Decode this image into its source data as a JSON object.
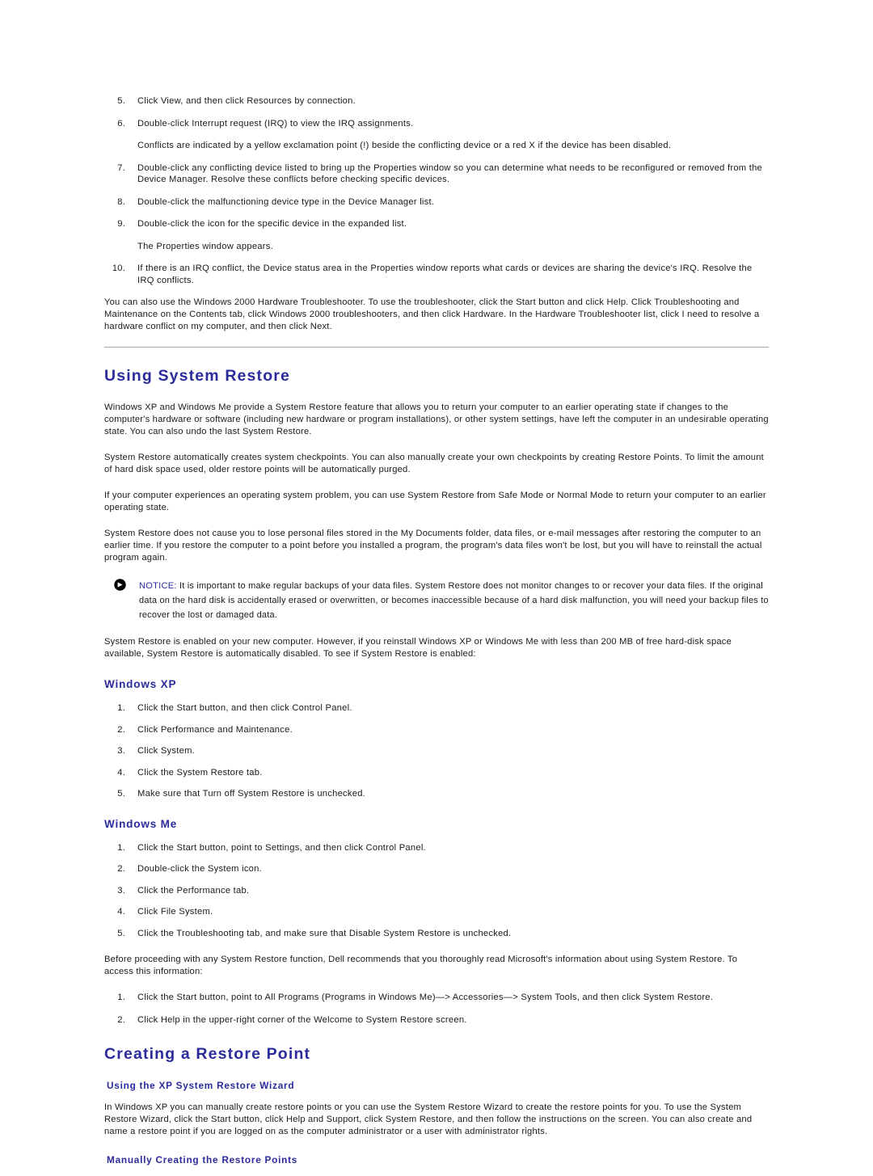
{
  "document": {
    "steps_continued": [
      {
        "num": "5.",
        "text": "Click View, and then click Resources by connection."
      },
      {
        "num": "6.",
        "text": "Double-click Interrupt request (IRQ) to view the IRQ assignments."
      }
    ],
    "conflict_note": "Conflicts are indicated by a yellow exclamation point (!) beside the conflicting device or a red X if the device has been disabled.",
    "steps_continued_2": [
      {
        "num": "7.",
        "text": "Double-click any conflicting device listed to bring up the Properties window so you can determine what needs to be reconfigured or removed from the Device Manager. Resolve these conflicts before checking specific devices."
      },
      {
        "num": "8.",
        "text": "Double-click the malfunctioning device type in the Device Manager list."
      },
      {
        "num": "9.",
        "text": "Double-click the icon for the specific device in the expanded list."
      }
    ],
    "properties_note": "The Properties window appears.",
    "steps_continued_3": [
      {
        "num": "10.",
        "text": "If there is an IRQ conflict, the Device status area in the Properties window reports what cards or devices are sharing the device's IRQ. Resolve the IRQ conflicts."
      }
    ],
    "troubleshooter_para": "You can also use the Windows 2000 Hardware Troubleshooter. To use the troubleshooter, click the Start button and click Help. Click Troubleshooting and Maintenance on the Contents tab, click Windows 2000 troubleshooters, and then click Hardware. In the Hardware Troubleshooter list, click I need to resolve a hardware conflict on my computer, and then click Next."
  },
  "section_system_restore": {
    "heading": "Using System Restore",
    "paragraphs": [
      "Windows XP and Windows Me provide a System Restore feature that allows you to return your computer to an earlier operating state if changes to the computer's hardware or software (including new hardware or program installations), or other system settings, have left the computer in an undesirable operating state. You can also undo the last System Restore.",
      "System Restore automatically creates system checkpoints. You can also manually create your own checkpoints by creating Restore Points. To limit the amount of hard disk space used, older restore points will be automatically purged.",
      "If your computer experiences an operating system problem, you can use System Restore from Safe Mode or Normal Mode to return your computer to an earlier operating state.",
      "System Restore does not cause you to lose personal files stored in the My Documents folder, data files, or e-mail messages after restoring the computer to an earlier time. If you restore the computer to a point before you installed a program, the program's data files won't be lost, but you will have to reinstall the actual program again."
    ],
    "notice": {
      "icon": "notice-arrow-icon",
      "label": "NOTICE:",
      "text": " It is important to make regular backups of your data files. System Restore does not monitor changes to or recover your data files. If the original data on the hard disk is accidentally erased or overwritten, or becomes inaccessible because of a hard disk malfunction, you will need your backup files to recover the lost or damaged data."
    },
    "enabled_para": "System Restore is enabled on your new computer. However, if you reinstall Windows XP or Windows Me with less than 200 MB of free hard-disk space available, System Restore is automatically disabled. To see if System Restore is enabled:",
    "windows_xp": {
      "heading": "Windows XP",
      "steps": [
        {
          "num": "1.",
          "text": "Click the Start button, and then click Control Panel."
        },
        {
          "num": "2.",
          "text": "Click Performance and Maintenance."
        },
        {
          "num": "3.",
          "text": "Click System."
        },
        {
          "num": "4.",
          "text": "Click the System Restore tab."
        },
        {
          "num": "5.",
          "text": "Make sure that Turn off System Restore is unchecked."
        }
      ]
    },
    "windows_me": {
      "heading": "Windows Me",
      "steps": [
        {
          "num": "1.",
          "text": "Click the Start button, point to Settings, and then click Control Panel."
        },
        {
          "num": "2.",
          "text": "Double-click the System icon."
        },
        {
          "num": "3.",
          "text": "Click the Performance tab."
        },
        {
          "num": "4.",
          "text": "Click File System."
        },
        {
          "num": "5.",
          "text": "Click the Troubleshooting tab, and make sure that Disable System Restore is unchecked."
        }
      ]
    },
    "microsoft_info_para": "Before proceeding with any System Restore function, Dell recommends that you thoroughly read Microsoft's information about using System Restore. To access this information:",
    "microsoft_info_steps": [
      {
        "num": "1.",
        "text": "Click the Start button, point to All Programs (Programs in Windows Me)—> Accessories—> System Tools, and then click System Restore."
      },
      {
        "num": "2.",
        "text": "Click Help in the upper-right corner of the Welcome to System Restore screen."
      }
    ]
  },
  "section_restore_point": {
    "heading": "Creating a Restore Point",
    "wizard_heading": "Using the XP System Restore Wizard",
    "wizard_para": "In Windows XP you can manually create restore points or you can use the System Restore Wizard to create the restore points for you. To use the System Restore Wizard, click the Start button, click Help and Support, click System Restore, and then follow the instructions on the screen. You can also create and name a restore point if you are logged on as the computer administrator or a user with administrator rights.",
    "manual_heading": "Manually Creating the Restore Points"
  },
  "colors": {
    "heading_blue": "#2b2b9c",
    "body_text": "#1a1a1a",
    "rule": "#a8a8a8"
  }
}
